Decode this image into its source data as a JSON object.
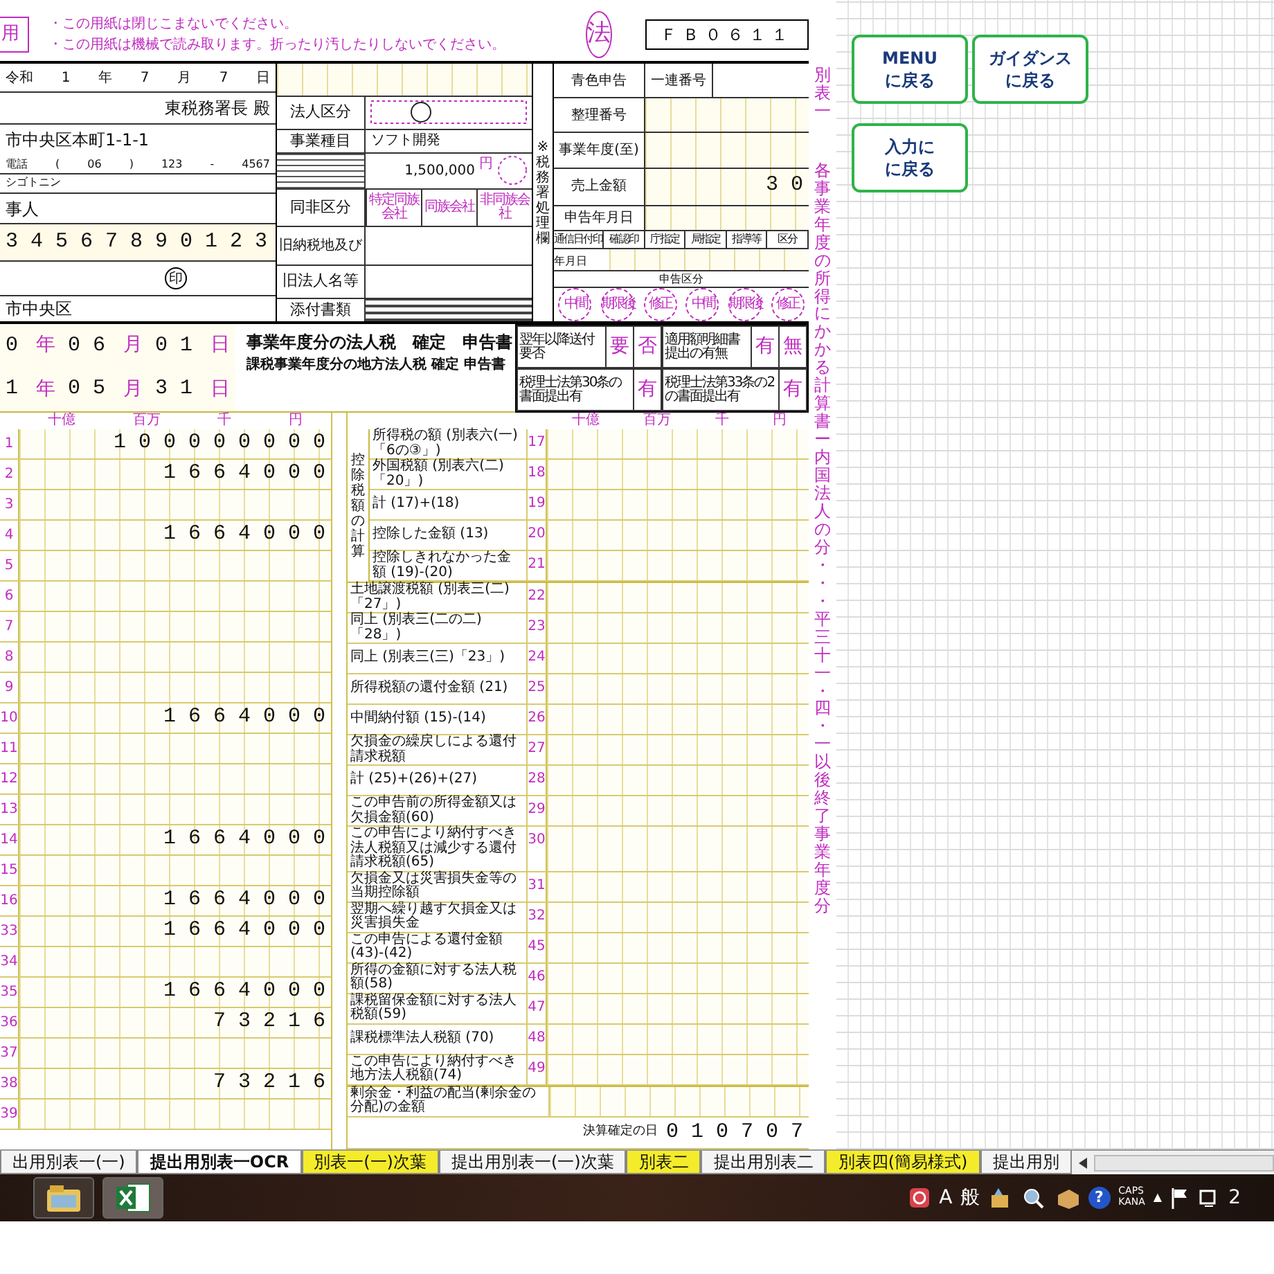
{
  "notice_box": "用",
  "notices": [
    "・この用紙は閉じこまないでください。",
    "・この用紙は機械で読み取ります。折ったり汚したりしないでください。"
  ],
  "form_mark": "法",
  "form_code": "ＦＢ０６１１",
  "header_left": {
    "filing_date": [
      "令和",
      "1",
      "年",
      "7",
      "月",
      "7",
      "日"
    ],
    "tax_office": "東税務署長 殿",
    "address": "市中央区本町1-1-1",
    "phone": [
      "電話",
      "(",
      "06",
      ")",
      "123",
      "-",
      "4567"
    ],
    "furigana": "シゴトニン",
    "name": "事人",
    "corporate_number": "34567890123",
    "seal": "印",
    "rep_address": "市中央区"
  },
  "header_mid": {
    "corp_class_label": "法人区分",
    "business_label": "事業種目",
    "business": "ソフト開発",
    "capital": "1,500,000",
    "capital_unit": "円",
    "family_label": "同非区分",
    "family_options": [
      "特定同族会社",
      "同族会社",
      "非同族会社"
    ],
    "old_place_label": "旧納税地及び",
    "old_name_label": "旧法人名等",
    "attachments_label": "添付書類"
  },
  "header_right": {
    "office_label": "※税務署処理欄",
    "blue_return": "青色申告",
    "serial_label": "一連番号",
    "ref_label": "整理番号",
    "period_label": "事業年度(至)",
    "sales_label": "売上金額",
    "sales": "30",
    "date_label": "申告年月日",
    "stamp_cols": [
      "通信日付印",
      "確認印",
      "庁指定",
      "局指定",
      "指導等",
      "区分"
    ],
    "ymd": "年月日",
    "filing_class": "申告区分",
    "filing_marks": [
      "中間",
      "期限後",
      "修正",
      "中間",
      "期限後",
      "修正"
    ]
  },
  "period": {
    "from": [
      "0",
      "年",
      "06",
      "月",
      "01",
      "日"
    ],
    "to": [
      "1",
      "年",
      "05",
      "月",
      "31",
      "日"
    ],
    "title": "事業年度分の法人税　確定　申告書",
    "subtitle": "課税事業年度分の地方法人税 確定 申告書"
  },
  "flags": [
    {
      "label": "翌年以降送付要否",
      "options": [
        "要",
        "否"
      ]
    },
    {
      "label": "適用額明細書提出の有無",
      "options": [
        "有",
        "無"
      ]
    },
    {
      "label": "税理士法第30条の書面提出有",
      "options": [
        "有"
      ]
    },
    {
      "label": "税理士法第33条の2の書面提出有",
      "options": [
        "有"
      ]
    }
  ],
  "unit_labels_left": [
    "十億",
    "百万",
    "千",
    "円"
  ],
  "unit_labels_right": [
    "十億",
    "百万",
    "千",
    "円"
  ],
  "left_rows": [
    {
      "no": "1",
      "amount": "100000000"
    },
    {
      "no": "2",
      "amount": "1664000"
    },
    {
      "no": "3"
    },
    {
      "no": "4",
      "amount": "1664000"
    },
    {
      "no": "5"
    },
    {
      "no": "6"
    },
    {
      "no": "7"
    },
    {
      "no": "8"
    },
    {
      "no": "9"
    },
    {
      "no": "10",
      "amount": "1664000"
    },
    {
      "no": "11"
    },
    {
      "no": "12"
    },
    {
      "no": "13"
    },
    {
      "no": "14",
      "amount": "1664000"
    },
    {
      "no": "15"
    },
    {
      "no": "16",
      "amount": "1664000"
    },
    {
      "no": "33",
      "amount": "1664000"
    },
    {
      "no": "34"
    },
    {
      "no": "35",
      "amount": "1664000"
    },
    {
      "no": "36",
      "amount": "73216"
    },
    {
      "no": "37"
    },
    {
      "no": "38",
      "amount": "73216"
    },
    {
      "no": "39"
    }
  ],
  "right_groups": [
    {
      "label": "控除税額の計算",
      "rows": [
        {
          "no": "17",
          "label": "所得税の額 (別表六(一)「6の③」)"
        },
        {
          "no": "18",
          "label": "外国税額 (別表六(二)「20」)"
        },
        {
          "no": "19",
          "label": "計 (17)+(18)"
        },
        {
          "no": "20",
          "label": "控除した金額 (13)"
        },
        {
          "no": "21",
          "label": "控除しきれなかった金額 (19)-(20)"
        }
      ]
    },
    {
      "rows": [
        {
          "no": "22",
          "label": "土地譲渡税額 (別表三(二)「27」)"
        },
        {
          "no": "23",
          "label": "同上 (別表三(二の二)「28」)"
        },
        {
          "no": "24",
          "label": "同上 (別表三(三)「23」)"
        },
        {
          "no": "25",
          "label": "所得税額の還付金額 (21)"
        },
        {
          "no": "26",
          "label": "中間納付額 (15)-(14)"
        },
        {
          "no": "27",
          "label": "欠損金の繰戻しによる還付請求税額"
        },
        {
          "no": "28",
          "label": "計 (25)+(26)+(27)"
        },
        {
          "no": "29",
          "label": "この申告前の所得金額又は欠損金額(60)"
        },
        {
          "no": "30",
          "label": "この申告により納付すべき法人税額又は減少する還付請求税額(65)"
        },
        {
          "no": "31",
          "label": "欠損金又は災害損失金等の当期控除額"
        },
        {
          "no": "32",
          "label": "翌期へ繰り越す欠損金又は災害損失金"
        },
        {
          "no": "45",
          "label": "この申告による還付金額 (43)-(42)"
        },
        {
          "no": "46",
          "label": "所得の金額に対する法人税額(58)"
        },
        {
          "no": "47",
          "label": "課税留保金額に対する法人税額(59)"
        },
        {
          "no": "48",
          "label": "課税標準法人税額 (70)"
        },
        {
          "no": "49",
          "label": "この申告により納付すべき地方法人税額(74)"
        }
      ]
    }
  ],
  "dividend_label": "剰余金・利益の配当(剰余金の分配)の金額",
  "settlement_label": "決算確定の日",
  "settlement_date": "010707",
  "side_title": "別表一",
  "side_subtitle": "各事業年度の所得にかかる計算書ー内国法人の分・・・平三十一・四・一以後終了事業年度分",
  "nav_buttons": [
    {
      "lines": [
        "MENU",
        "に戻る"
      ]
    },
    {
      "lines": [
        "ガイダンス",
        "に戻る"
      ]
    },
    {
      "lines": [
        "入力に",
        "に戻る"
      ]
    }
  ],
  "sheet_tabs": [
    {
      "label": "出用別表一(一)",
      "selected": false,
      "highlighted": false
    },
    {
      "label": "提出用別表一OCR",
      "selected": true,
      "highlighted": false
    },
    {
      "label": "別表一(一)次葉",
      "selected": false,
      "highlighted": true
    },
    {
      "label": "提出用別表一(一)次葉",
      "selected": false,
      "highlighted": false
    },
    {
      "label": "別表二",
      "selected": false,
      "highlighted": true
    },
    {
      "label": "提出用別表二",
      "selected": false,
      "highlighted": false
    },
    {
      "label": "別表四(簡易様式)",
      "selected": false,
      "highlighted": true
    },
    {
      "label": "提出用別",
      "selected": false,
      "highlighted": false
    }
  ],
  "taskbar": {
    "ime": [
      "A",
      "般"
    ],
    "help": "?",
    "caps": "CAPS",
    "kana": "KANA",
    "tray_arrow": "▲",
    "clock": "2"
  }
}
